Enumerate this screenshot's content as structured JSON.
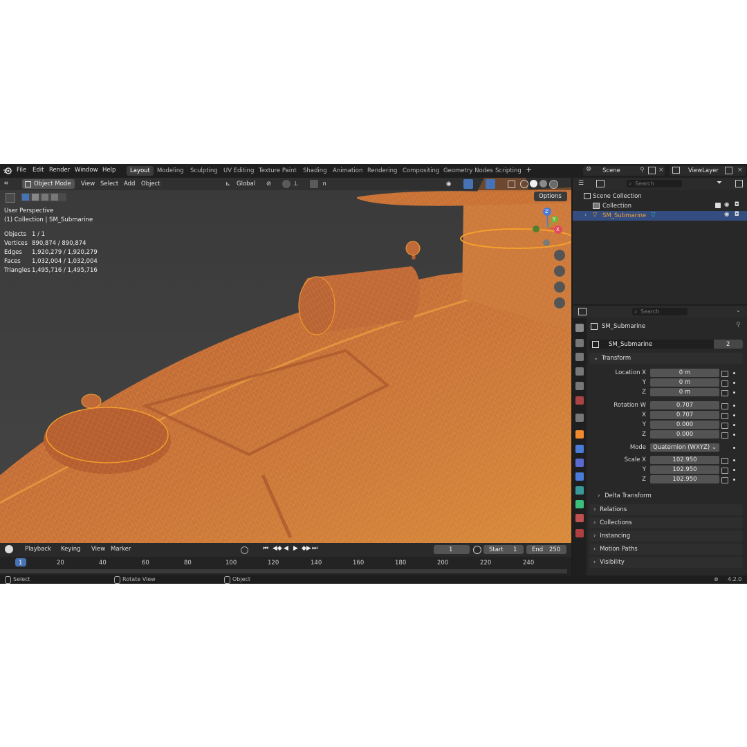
{
  "app": {
    "version": "4.2.0",
    "menu": [
      "File",
      "Edit",
      "Render",
      "Window",
      "Help"
    ],
    "workspaces": [
      "Layout",
      "Modeling",
      "Sculpting",
      "UV Editing",
      "Texture Paint",
      "Shading",
      "Animation",
      "Rendering",
      "Compositing",
      "Geometry Nodes",
      "Scripting"
    ],
    "active_workspace": "Layout",
    "scene": "Scene",
    "view_layer": "ViewLayer"
  },
  "viewport": {
    "mode": "Object Mode",
    "header_menus": [
      "View",
      "Select",
      "Add",
      "Object"
    ],
    "orientation": "Global",
    "options_label": "Options",
    "perspective": "User Perspective",
    "context": "(1) Collection | SM_Submarine",
    "stats": [
      {
        "label": "Objects",
        "value": "1 / 1"
      },
      {
        "label": "Vertices",
        "value": "890,874 / 890,874"
      },
      {
        "label": "Edges",
        "value": "1,920,279 / 1,920,279"
      },
      {
        "label": "Faces",
        "value": "1,032,004 / 1,032,004"
      },
      {
        "label": "Triangles",
        "value": "1,495,716 / 1,495,716"
      }
    ],
    "gizmo": {
      "x": "X",
      "y": "Y",
      "z": "Z"
    }
  },
  "timeline": {
    "menus": [
      "Playback",
      "Keying",
      "View",
      "Marker"
    ],
    "current_frame": "1",
    "start_label": "Start",
    "start": "1",
    "end_label": "End",
    "end": "250",
    "ruler": [
      "1",
      "20",
      "40",
      "60",
      "80",
      "100",
      "120",
      "140",
      "160",
      "180",
      "200",
      "220",
      "240"
    ]
  },
  "statusbar": {
    "select": "Select",
    "rotate": "Rotate View",
    "object": "Object"
  },
  "outliner": {
    "search_placeholder": "Search",
    "root": "Scene Collection",
    "collection": "Collection",
    "object": "SM_Submarine"
  },
  "properties": {
    "search_placeholder": "Search",
    "object_name": "SM_Submarine",
    "data_name": "SM_Submarine",
    "users": "2",
    "transform_label": "Transform",
    "location": {
      "label_x": "Location X",
      "label_y": "Y",
      "label_z": "Z",
      "x": "0 m",
      "y": "0 m",
      "z": "0 m"
    },
    "rotation": {
      "label_w": "Rotation W",
      "label_x": "X",
      "label_y": "Y",
      "label_z": "Z",
      "w": "0.707",
      "x": "0.707",
      "y": "0.000",
      "z": "0.000"
    },
    "mode_label": "Mode",
    "mode": "Quaternion (WXYZ)",
    "scale": {
      "label_x": "Scale X",
      "label_y": "Y",
      "label_z": "Z",
      "x": "102.950",
      "y": "102.950",
      "z": "102.950"
    },
    "delta": "Delta Transform",
    "panels": [
      "Relations",
      "Collections",
      "Instancing",
      "Motion Paths",
      "Visibility"
    ]
  },
  "colors": {
    "selection_orange": "#f5a02c",
    "active_blue": "#4772b3",
    "model_body": "#c06a3a"
  }
}
